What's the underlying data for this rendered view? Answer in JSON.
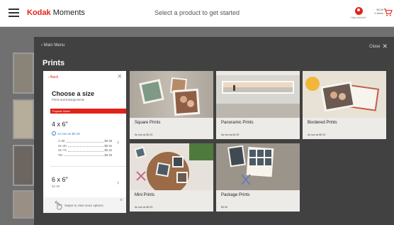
{
  "header": {
    "brand_first": "Kodak",
    "brand_second": "Moments",
    "prompt": "Select a product to get started",
    "help_label": "Help needed?",
    "cart_amount": "$0.00",
    "cart_items": "0 Items"
  },
  "overlay": {
    "back_label": "Main Menu",
    "close_label": "Close",
    "title": "Prints"
  },
  "size_panel": {
    "back_label": "Back",
    "heading": "Choose a size",
    "subheading": "Prints and Enlargements",
    "popular_label": "Popular Sizes",
    "option1": {
      "size": "4 x 6\"",
      "as_low_as": "As low as $0.29",
      "tiers": [
        {
          "range": "1–20",
          "price": "$0.39"
        },
        {
          "range": "21–40",
          "price": "$0.34"
        },
        {
          "range": "41–74",
          "price": "$0.32"
        },
        {
          "range": "75+",
          "price": "$0.29"
        }
      ]
    },
    "option2": {
      "size": "6 x 6\"",
      "price": "$2.99"
    },
    "swipe_hint": "Swipe to view more options"
  },
  "products": [
    {
      "name": "Square Prints",
      "price": "As low as $0.39"
    },
    {
      "name": "Panoramic Prints",
      "price": "As low as $4.99"
    },
    {
      "name": "Bordered Prints",
      "price": "As low as $0.29"
    },
    {
      "name": "Mini Prints",
      "price": "As low as $0.25"
    },
    {
      "name": "Package Prints",
      "price": "$3.99"
    }
  ],
  "colors": {
    "brand_red": "#e2231a",
    "overlay_bg": "#414141",
    "tile_bg": "#ecebe8"
  }
}
